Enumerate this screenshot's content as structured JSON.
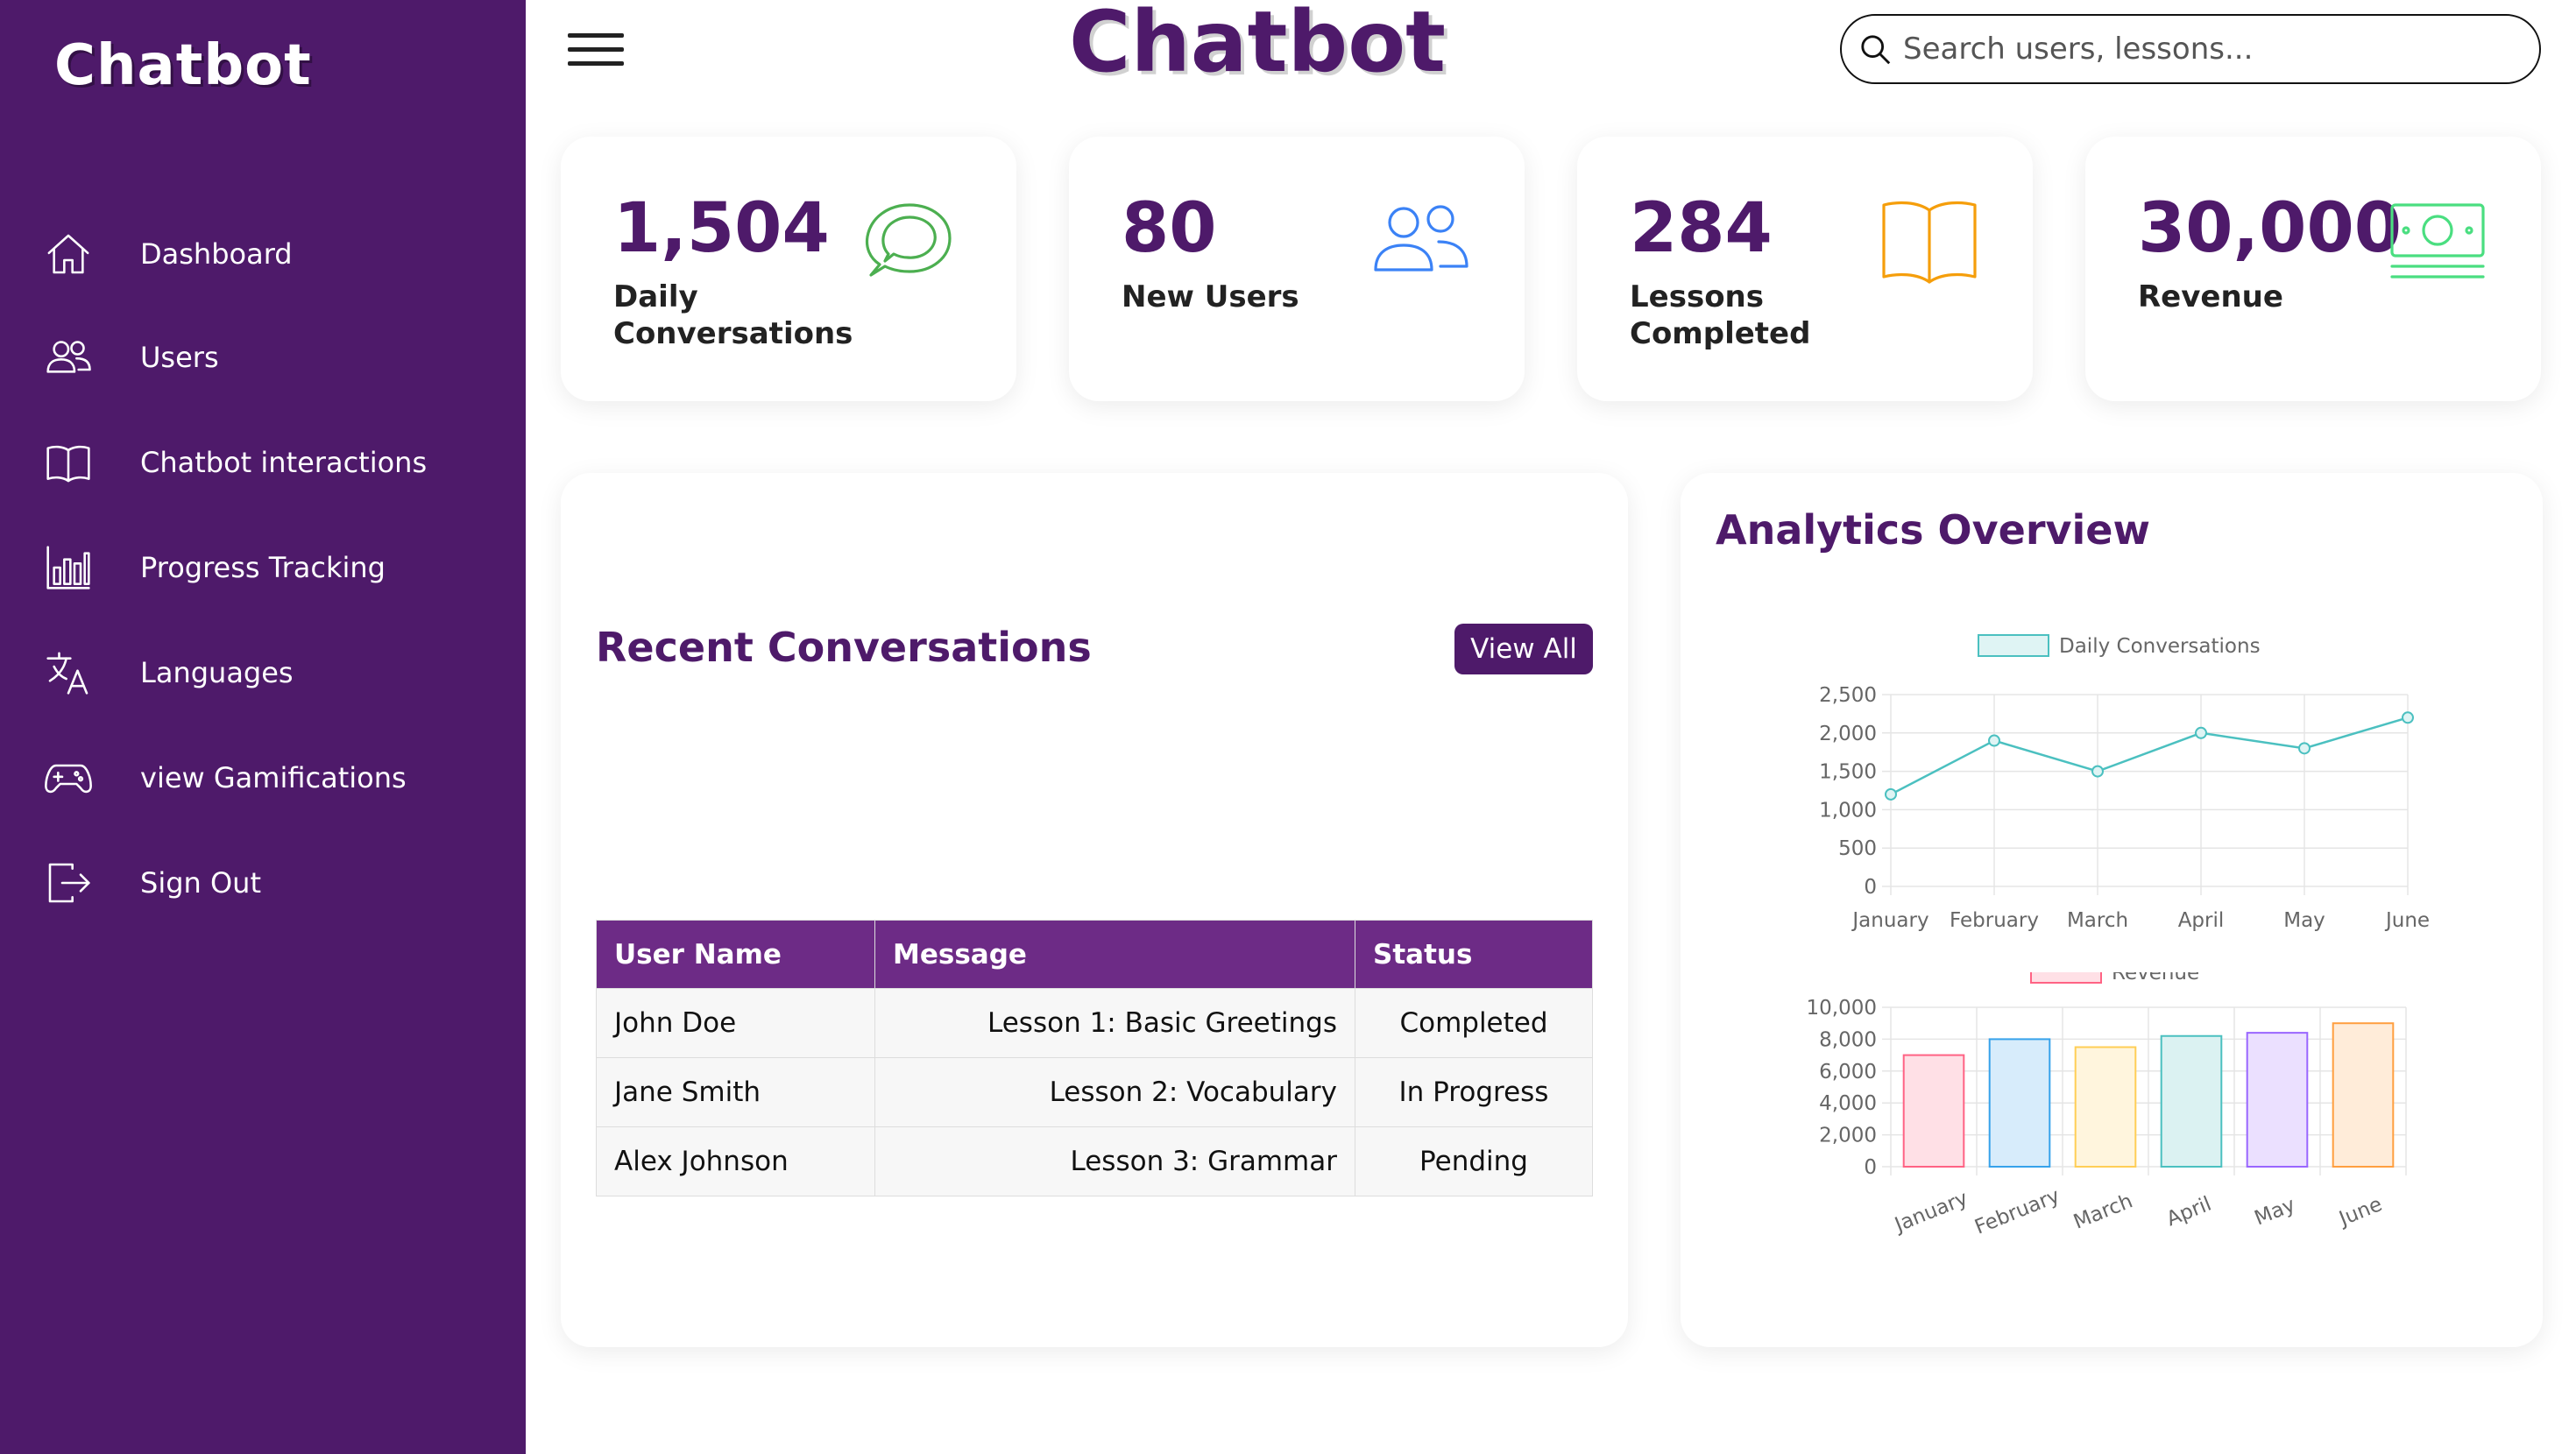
{
  "sidebar": {
    "brand": "Chatbot",
    "items": [
      {
        "label": "Dashboard",
        "icon": "home-icon"
      },
      {
        "label": "Users",
        "icon": "users-icon"
      },
      {
        "label": "Chatbot interactions",
        "icon": "book-icon"
      },
      {
        "label": "Progress Tracking",
        "icon": "bar-chart-icon"
      },
      {
        "label": "Languages",
        "icon": "translate-icon"
      },
      {
        "label": "view Gamifications",
        "icon": "gamepad-icon"
      },
      {
        "label": "Sign Out",
        "icon": "sign-out-icon"
      }
    ]
  },
  "header": {
    "title": "Chatbot",
    "search_placeholder": "Search users, lessons..."
  },
  "stats": [
    {
      "value": "1,504",
      "label": "Daily Conversations",
      "icon": "chat-icon",
      "color": "#4caf50"
    },
    {
      "value": "80",
      "label": "New Users",
      "icon": "users-icon",
      "color": "#3b82f6"
    },
    {
      "value": "284",
      "label": "Lessons Completed",
      "icon": "book-icon",
      "color": "#f59e0b"
    },
    {
      "value": "30,000",
      "label": "Revenue",
      "icon": "money-icon",
      "color": "#4ade80"
    }
  ],
  "conversations": {
    "title": "Recent Conversations",
    "view_all": "View All",
    "columns": [
      "User Name",
      "Message",
      "Status"
    ],
    "rows": [
      [
        "John Doe",
        "Lesson 1: Basic Greetings",
        "Completed"
      ],
      [
        "Jane Smith",
        "Lesson 2: Vocabulary",
        "In Progress"
      ],
      [
        "Alex Johnson",
        "Lesson 3: Grammar",
        "Pending"
      ]
    ]
  },
  "analytics": {
    "title": "Analytics Overview"
  },
  "colors": {
    "primary": "#4e1a6a",
    "table_header": "#6d2b86"
  },
  "chart_data": [
    {
      "type": "line",
      "categories": [
        "January",
        "February",
        "March",
        "April",
        "May",
        "June"
      ],
      "series": [
        {
          "name": "Daily Conversations",
          "values": [
            1200,
            1900,
            1500,
            2000,
            1800,
            2200
          ]
        }
      ],
      "ylim": [
        0,
        2500
      ],
      "yticks": [
        "0",
        "500",
        "1,000",
        "1,500",
        "2,000",
        "2,500"
      ],
      "legend": "top",
      "grid": true,
      "colors": {
        "line": "#4bc0c0",
        "fill": "#dff4f4"
      }
    },
    {
      "type": "bar",
      "categories": [
        "January",
        "February",
        "March",
        "April",
        "May",
        "June"
      ],
      "series": [
        {
          "name": "Revenue",
          "values": [
            7000,
            8000,
            7500,
            8200,
            8400,
            9000
          ]
        }
      ],
      "ylim": [
        0,
        10000
      ],
      "yticks": [
        "0",
        "2,000",
        "4,000",
        "6,000",
        "8,000",
        "10,000"
      ],
      "legend": "top",
      "grid": true,
      "bar_colors": [
        {
          "fill": "#ffe0e6",
          "stroke": "#ff6384"
        },
        {
          "fill": "#d7ecfb",
          "stroke": "#36a2eb"
        },
        {
          "fill": "#fff5dd",
          "stroke": "#ffce56"
        },
        {
          "fill": "#dbf2f2",
          "stroke": "#4bc0c0"
        },
        {
          "fill": "#ebe0ff",
          "stroke": "#9966ff"
        },
        {
          "fill": "#ffecd9",
          "stroke": "#ff9f40"
        }
      ],
      "legend_colors": {
        "fill": "#ffe0e6",
        "stroke": "#ff6384"
      }
    }
  ]
}
